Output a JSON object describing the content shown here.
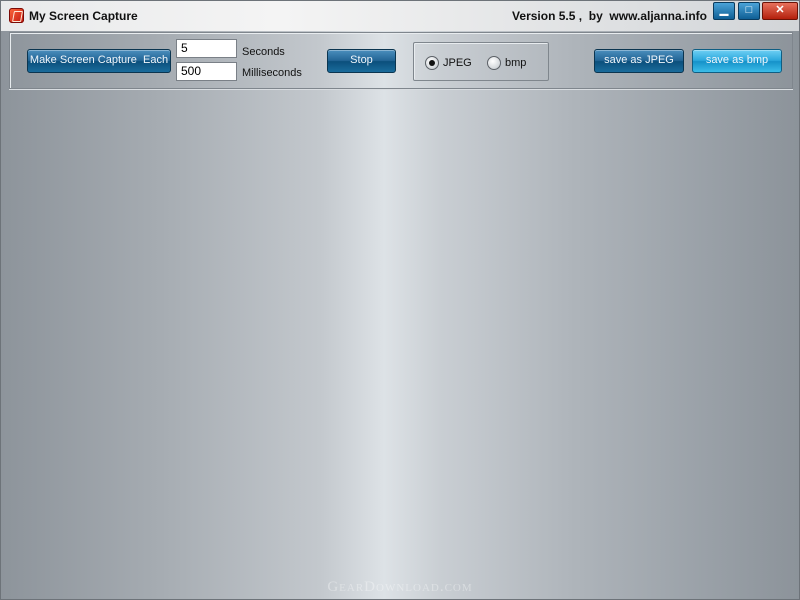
{
  "window": {
    "title": "My Screen Capture",
    "version_text": "Version 5.5 ,  by  www.aljanna.info",
    "minimize_glyph": "▁",
    "maximize_glyph": "□",
    "close_glyph": "✕"
  },
  "toolbar": {
    "capture_button_label": "Make Screen Capture  Each",
    "seconds_value": "5",
    "seconds_label": "Seconds",
    "milliseconds_value": "500",
    "milliseconds_label": "Milliseconds",
    "stop_button_label": "Stop",
    "format_options": [
      {
        "label": "JPEG",
        "checked": true
      },
      {
        "label": "bmp",
        "checked": false
      }
    ],
    "save_jpeg_label": "save as JPEG",
    "save_bmp_label": "save as bmp"
  },
  "watermark": "GearDownload.com",
  "colors": {
    "accent_button": "#236595",
    "accent_button_bright": "#2aa7dc",
    "close_button": "#c73a22"
  }
}
